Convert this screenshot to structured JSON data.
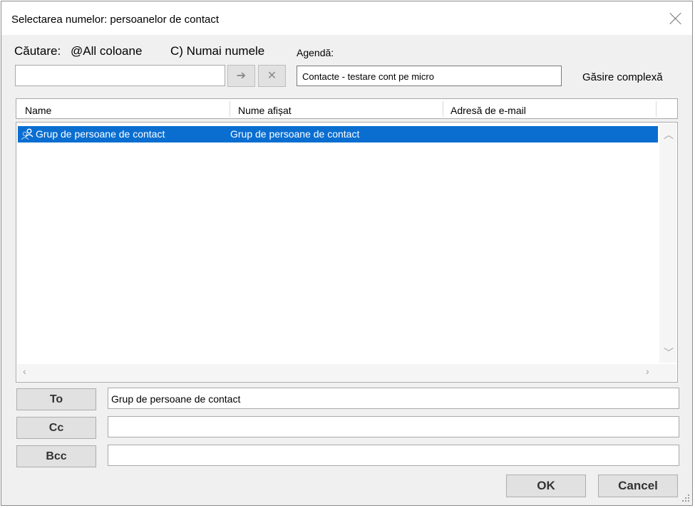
{
  "window": {
    "title": "Selectarea numelor: persoanelor de contact"
  },
  "search": {
    "label": "Căutare:",
    "option_all": "@All coloane",
    "option_names": "C) Numai numele",
    "value": "",
    "go_icon": "arrow-right-icon",
    "clear_icon": "close-icon"
  },
  "address_book": {
    "label": "Agendă:",
    "selected": "Contacte - testare cont pe micro",
    "advanced_label": "Găsire complexă"
  },
  "list": {
    "columns": [
      "Name",
      "Nume afișat",
      "Adresă de e-mail"
    ],
    "rows": [
      {
        "icon": "contact-group-icon",
        "name": "Grup de persoane de contact",
        "display_name": "Grup de persoane de contact",
        "email": "",
        "selected": true
      }
    ]
  },
  "recipients": {
    "to_label": "To",
    "to_value": "Grup de persoane de contact",
    "cc_label": "Cc",
    "cc_value": "",
    "bcc_label": "Bcc",
    "bcc_value": ""
  },
  "buttons": {
    "ok": "OK",
    "cancel": "Cancel"
  },
  "colors": {
    "selection": "#0a6ed1",
    "dialog_bg": "#f0f0f0"
  }
}
